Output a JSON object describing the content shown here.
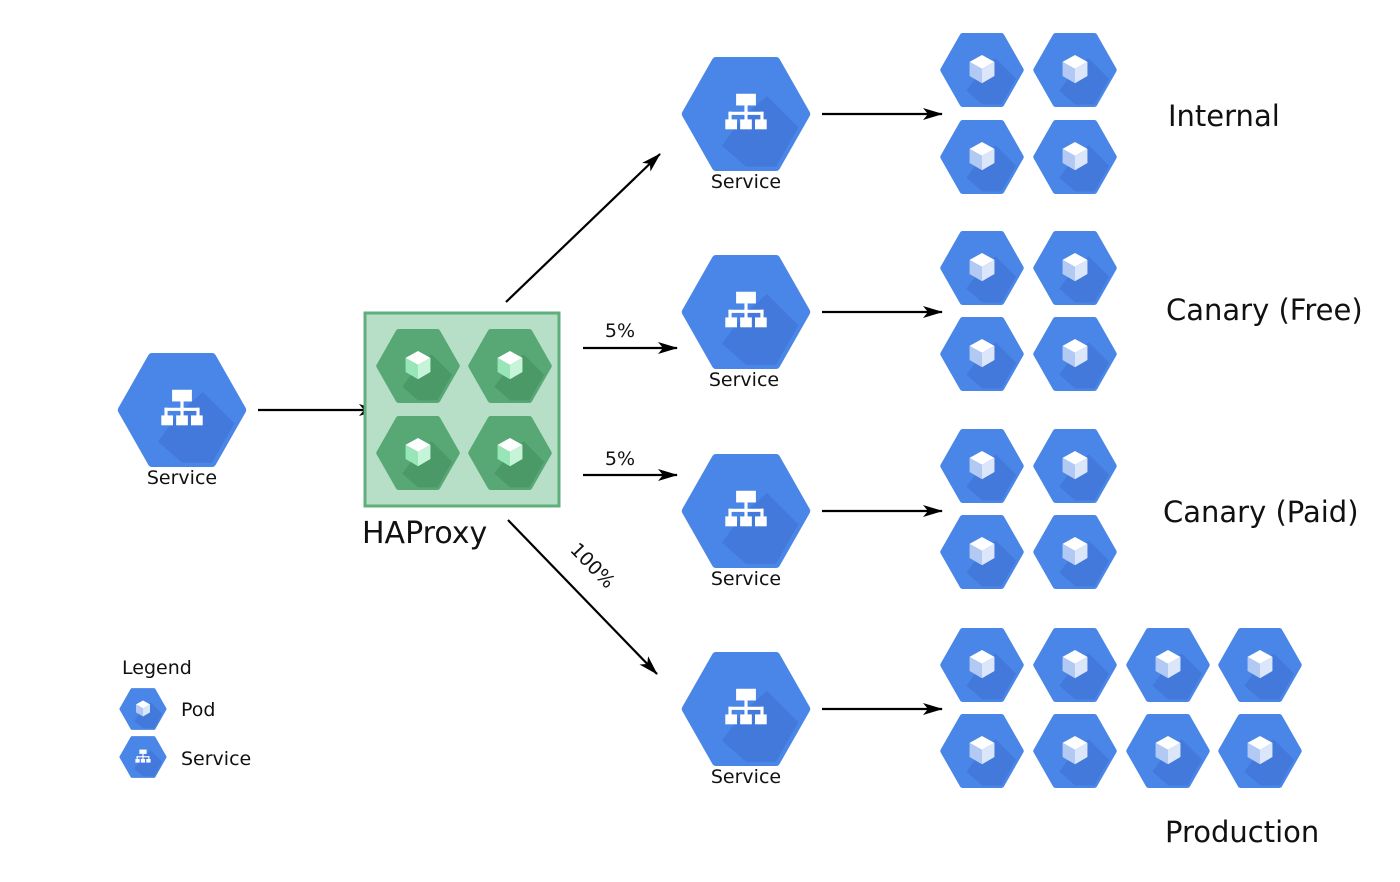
{
  "colors": {
    "service_hex": "#4a86e8",
    "service_shadow": "#3d6fcf",
    "pod_hex": "#4a86e8",
    "haproxy_box_fill": "#b7dec7",
    "haproxy_box_stroke": "#5fae7c",
    "haproxy_pod_hex": "#57a874",
    "cube_blue_top": "#ffffff",
    "cube_blue_right": "#dbe6fb",
    "cube_blue_left": "#b2c9f4",
    "cube_green_top": "#ffffff",
    "cube_green_right": "#c6f4d9",
    "cube_green_left": "#98e6b8",
    "arrow": "#000000"
  },
  "entry_service": {
    "label": "Service",
    "icon": "service-icon"
  },
  "haproxy": {
    "label": "HAProxy",
    "pod_count": 4,
    "icon": "pod-icon"
  },
  "routes": [
    {
      "id": "internal",
      "weight_label": "",
      "service_label": "Service",
      "group_label": "Internal",
      "pod_count": 4
    },
    {
      "id": "canary-free",
      "weight_label": "5%",
      "service_label": "Service",
      "group_label": "Canary (Free)",
      "pod_count": 4
    },
    {
      "id": "canary-paid",
      "weight_label": "5%",
      "service_label": "Service",
      "group_label": "Canary (Paid)",
      "pod_count": 4
    },
    {
      "id": "production",
      "weight_label": "100%",
      "service_label": "Service",
      "group_label": "Production",
      "pod_count": 8
    }
  ],
  "legend": {
    "title": "Legend",
    "items": [
      {
        "label": "Pod",
        "icon": "pod-icon"
      },
      {
        "label": "Service",
        "icon": "service-icon"
      }
    ]
  }
}
